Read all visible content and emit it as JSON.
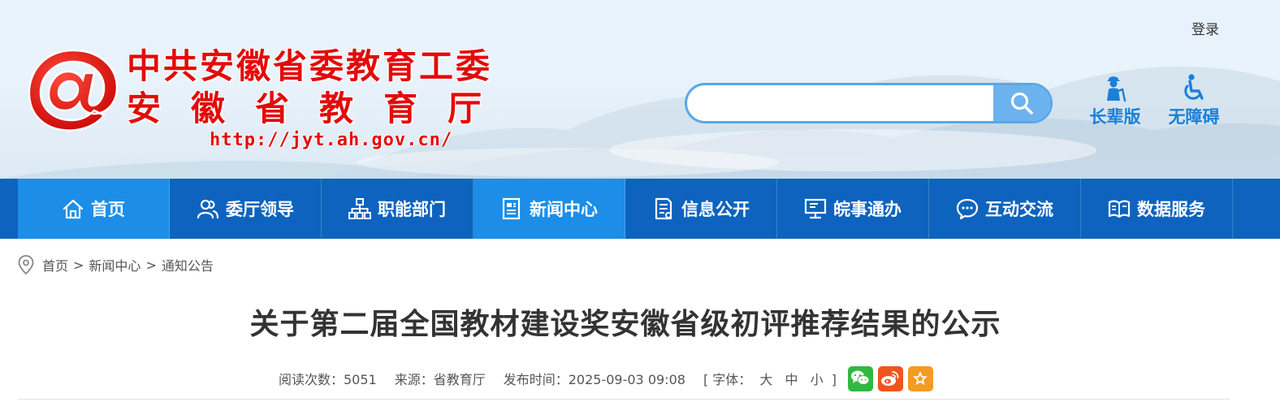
{
  "header": {
    "login": "登录",
    "brand_line1": "中共安徽省委教育工委",
    "brand_line2": "安徽省教育厅",
    "brand_url": "http://jyt.ah.gov.cn/",
    "search_placeholder": "",
    "tools": [
      {
        "label": "长辈版",
        "icon": "elder-icon"
      },
      {
        "label": "无障碍",
        "icon": "accessibility-icon"
      }
    ],
    "brand_color": "#e30b0b",
    "accent_color": "#1a7fd9"
  },
  "nav": {
    "items": [
      {
        "label": "首页",
        "icon": "home-icon"
      },
      {
        "label": "委厅领导",
        "icon": "leaders-icon"
      },
      {
        "label": "职能部门",
        "icon": "org-chart-icon"
      },
      {
        "label": "新闻中心",
        "icon": "news-icon"
      },
      {
        "label": "信息公开",
        "icon": "document-icon"
      },
      {
        "label": "皖事通办",
        "icon": "computer-icon"
      },
      {
        "label": "互动交流",
        "icon": "chat-icon"
      },
      {
        "label": "数据服务",
        "icon": "book-icon"
      }
    ],
    "active": "新闻中心",
    "bar_color": "#0e63be",
    "active_color": "#1c8ee8"
  },
  "breadcrumb": {
    "items": [
      "首页",
      "新闻中心",
      "通知公告"
    ],
    "separator": ">"
  },
  "article": {
    "title": "关于第二届全国教材建设奖安徽省级初评推荐结果的公示",
    "views": "阅读次数：5051",
    "source": "来源：省教育厅",
    "published": "发布时间：2025-09-03 09:08",
    "font_size_label": "[ 字体：",
    "font_sizes": [
      "大",
      "中",
      "小"
    ],
    "font_size_close": "]",
    "share": [
      {
        "name": "wechat",
        "icon": "wechat-icon",
        "color": "#2fb940"
      },
      {
        "name": "weibo",
        "icon": "weibo-icon",
        "color": "#f0541e"
      },
      {
        "name": "favorite",
        "icon": "star-icon",
        "color": "#f59a23"
      }
    ]
  }
}
